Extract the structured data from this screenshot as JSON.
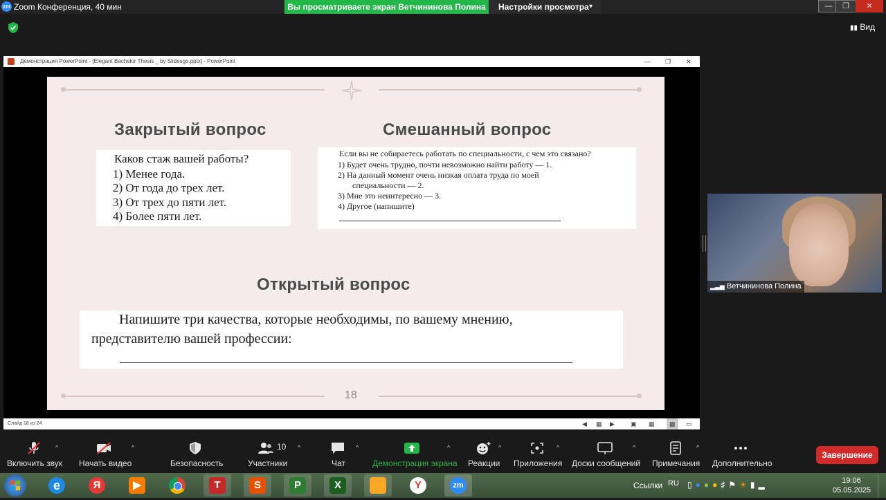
{
  "zoom": {
    "title": "Zoom Конференция, 40 мин",
    "logo": "zm",
    "share_banner": "Вы просматриваете экран Ветчининова Полина",
    "view_settings": "Настройки просмотра",
    "view_button": "Вид"
  },
  "ppt": {
    "window_title": "Демонстрация PowerPoint - [Elegant Bachelor Thesis _ by Slidesgo.pptx] - PowerPoint",
    "status": "Слайд 18 из 24",
    "slide": {
      "heading_closed": "Закрытый вопрос",
      "heading_mixed": "Смешанный вопрос",
      "heading_open": "Открытый вопрос",
      "closed_question": "Каков стаж вашей работы?",
      "closed_items": [
        "1)  Менее года.",
        "2)  От года до трех лет.",
        "3)  От трех до пяти лет.",
        "4)  Более пяти лет."
      ],
      "mixed_question": "Если вы не собираетесь работать по специальности, с чем это связано?",
      "mixed_items": [
        "1)  Будет очень трудно, почти невозможно найти работу — 1.",
        "2)  На данный момент очень низкая оплата труда по моей",
        "специальности — 2.",
        "3)  Мне это неинтересно — 3.",
        "4)  Другое (напишите)"
      ],
      "open_question_line1": "Напишите три качества, которые необходимы, по вашему мнению,",
      "open_question_line2": "представителю вашей профессии:",
      "page_number": "18"
    }
  },
  "participant": {
    "name": "Ветчининова Полина"
  },
  "toolbar": {
    "items": [
      {
        "label": "Включить звук",
        "icon": "mic-muted-icon"
      },
      {
        "label": "Начать видео",
        "icon": "video-off-icon"
      },
      {
        "label": "Безопасность",
        "icon": "shield-icon"
      },
      {
        "label": "Участники",
        "icon": "participants-icon",
        "count": "10"
      },
      {
        "label": "Чат",
        "icon": "chat-icon"
      },
      {
        "label": "Демонстрация экрана",
        "icon": "share-screen-icon",
        "color": "#23b74a"
      },
      {
        "label": "Реакции",
        "icon": "reactions-icon"
      },
      {
        "label": "Приложения",
        "icon": "apps-icon"
      },
      {
        "label": "Доски сообщений",
        "icon": "whiteboard-icon"
      },
      {
        "label": "Примечания",
        "icon": "notes-icon"
      },
      {
        "label": "Дополнительно",
        "icon": "more-icon"
      }
    ],
    "end_button": "Завершение"
  },
  "taskbar": {
    "apps": [
      "start",
      "internet-explorer",
      "yandex",
      "video",
      "chrome",
      "text",
      "powerpoint-s",
      "project",
      "excel",
      "explorer",
      "yandex-browser",
      "zoom"
    ],
    "yandex_letter": "Я",
    "zoom_label": "zm",
    "links": "Ссылки",
    "language": "RU",
    "time": "19:06",
    "date": "05.05.2025"
  },
  "colors": {
    "accent_green": "#23b74a",
    "end_red": "#d02a2a",
    "zoom_blue": "#2d8cff"
  }
}
